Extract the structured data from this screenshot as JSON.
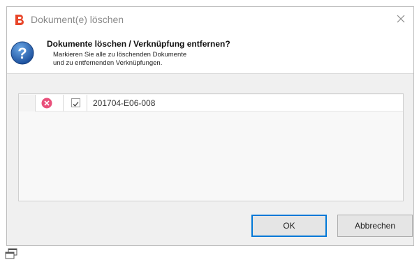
{
  "window": {
    "title": "Dokument(e) löschen",
    "close_glyph": "✕",
    "accent_color": "#0078d7",
    "brand_color": "#e8462a"
  },
  "header": {
    "title": "Dokumente löschen / Verknüpfung entfernen?",
    "line1": "Markieren Sie alle zu löschenden Dokumente",
    "line2": "und zu entfernenden Verknüpfungen.",
    "icon": "question-icon"
  },
  "list": {
    "rows": [
      {
        "name": "201704-E06-008",
        "checked": true,
        "status_icon": "remove-icon"
      }
    ]
  },
  "buttons": {
    "ok_label": "OK",
    "cancel_label": "Abbrechen"
  },
  "footer": {
    "icon": "window-restore-icon"
  }
}
